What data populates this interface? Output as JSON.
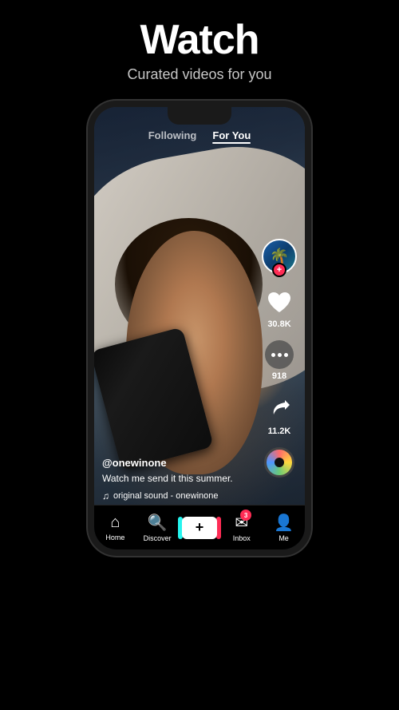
{
  "header": {
    "title": "Watch",
    "subtitle": "Curated videos for you"
  },
  "phone": {
    "topNav": {
      "following": "Following",
      "forYou": "For You",
      "activeTab": "forYou",
      "liveDot": true
    },
    "video": {
      "username": "@onewinone",
      "caption": "Watch me send it this summer.",
      "sound": "original sound - onewinone"
    },
    "actions": {
      "likes": "30.8K",
      "comments": "918",
      "shares": "11.2K"
    },
    "bottomNav": {
      "home": "Home",
      "discover": "Discover",
      "add": "+",
      "inbox": "Inbox",
      "inboxBadge": "3",
      "me": "Me"
    }
  }
}
